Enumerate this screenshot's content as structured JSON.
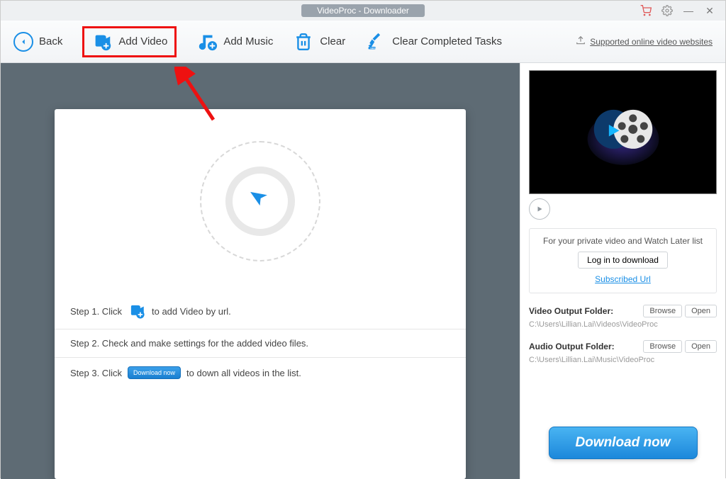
{
  "title": "VideoProc - Downloader",
  "toolbar": {
    "back": "Back",
    "add_video": "Add Video",
    "add_music": "Add Music",
    "clear": "Clear",
    "clear_completed": "Clear Completed Tasks",
    "websites_link": "Supported online video websites"
  },
  "steps": {
    "s1a": "Step 1. Click",
    "s1b": "to add Video by url.",
    "s2": "Step 2. Check and make settings for the added video files.",
    "s3a": "Step 3. Click",
    "s3_btn": "Download now",
    "s3b": "to down all videos in the list."
  },
  "right": {
    "private_text": "For your private video and Watch Later list",
    "login_btn": "Log in to download",
    "subscribed": "Subscribed Url",
    "video_folder_label": "Video Output Folder:",
    "video_folder_path": "C:\\Users\\Lillian.Lai\\Videos\\VideoProc",
    "audio_folder_label": "Audio Output Folder:",
    "audio_folder_path": "C:\\Users\\Lillian.Lai\\Music\\VideoProc",
    "browse": "Browse",
    "open": "Open",
    "download_now": "Download now"
  }
}
